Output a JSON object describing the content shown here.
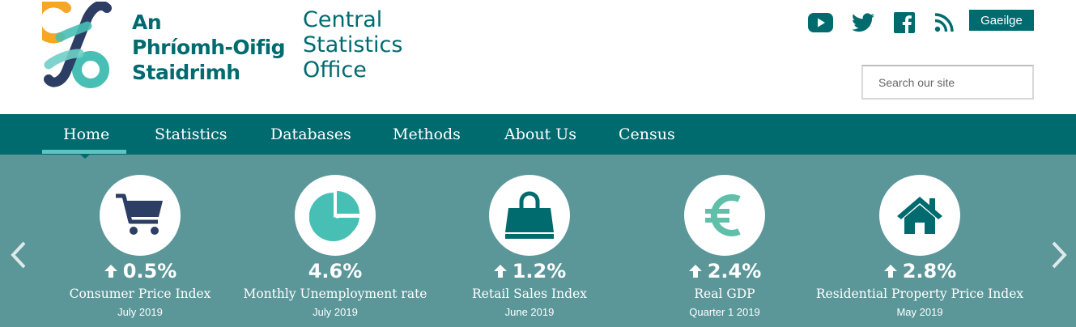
{
  "header": {
    "brand_irish": [
      "An",
      "Phríomh-Oifig",
      "Staidrimh"
    ],
    "brand_english": [
      "Central",
      "Statistics",
      "Office"
    ],
    "social_icons": [
      "youtube-icon",
      "twitter-icon",
      "facebook-icon",
      "rss-icon"
    ],
    "language_button": "Gaeilge",
    "search_placeholder": "Search our site"
  },
  "nav": {
    "items": [
      "Home",
      "Statistics",
      "Databases",
      "Methods",
      "About Us",
      "Census"
    ],
    "active": "Home"
  },
  "stats": [
    {
      "icon": "shopping-cart-icon",
      "value": "0.5%",
      "trend": "up",
      "label": "Consumer Price Index",
      "period": "July 2019"
    },
    {
      "icon": "pie-chart-icon",
      "value": "4.6%",
      "trend": "none",
      "label": "Monthly Unemployment rate",
      "period": "July 2019"
    },
    {
      "icon": "shopping-bag-icon",
      "value": "1.2%",
      "trend": "up",
      "label": "Retail Sales Index",
      "period": "June 2019"
    },
    {
      "icon": "euro-icon",
      "value": "2.4%",
      "trend": "up",
      "label": "Real GDP",
      "period": "Quarter 1 2019"
    },
    {
      "icon": "house-icon",
      "value": "2.8%",
      "trend": "up",
      "label": "Residential Property Price Index",
      "period": "May 2019"
    }
  ],
  "colors": {
    "brand_teal": "#006b6f",
    "band": "#5b9699",
    "accent": "#5fc5c1",
    "icon_navy": "#2c3e63",
    "logo_orange": "#f5a623"
  }
}
